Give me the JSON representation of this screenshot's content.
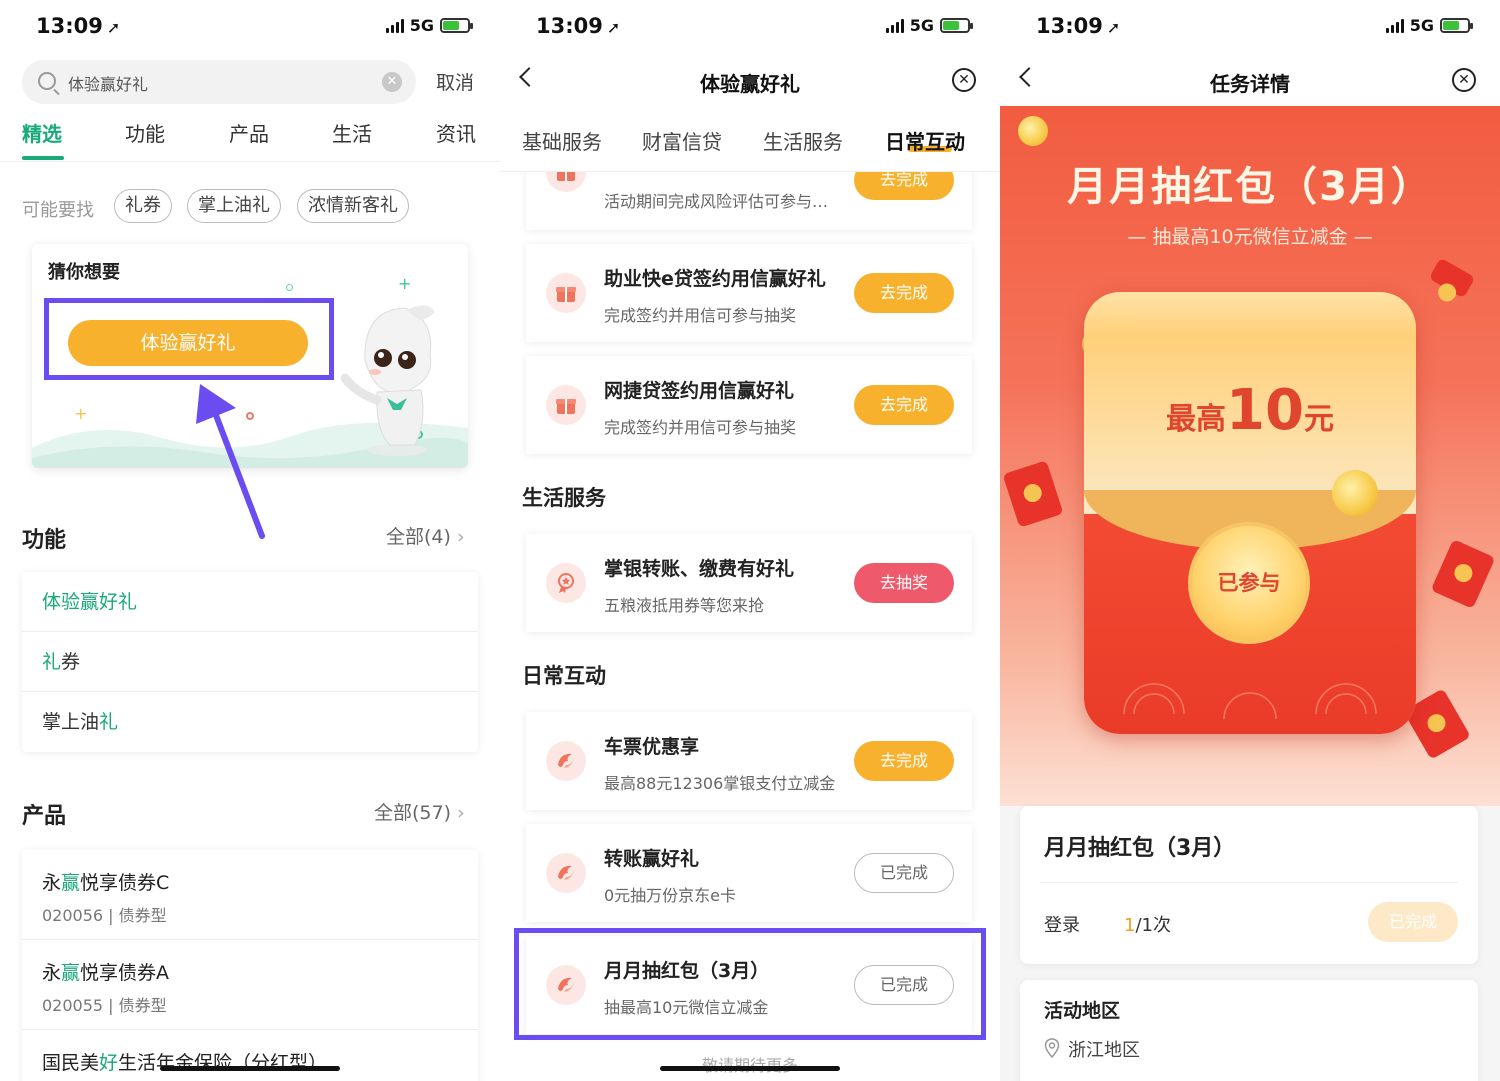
{
  "status": {
    "time": "13:09",
    "network": "5G"
  },
  "p1": {
    "search": {
      "query": "体验赢好礼",
      "cancel": "取消"
    },
    "tabs": [
      "精选",
      "功能",
      "产品",
      "生活",
      "资讯"
    ],
    "maybe_label": "可能要找",
    "chips": [
      "礼券",
      "掌上油礼",
      "浓情新客礼"
    ],
    "guess": {
      "title": "猜你想要",
      "button": "体验赢好礼"
    },
    "func": {
      "title": "功能",
      "all": "全部(4)"
    },
    "func_items": [
      {
        "pre": "",
        "hl": "体验赢好礼",
        "post": ""
      },
      {
        "pre": "",
        "hl": "礼",
        "post": "券"
      },
      {
        "pre": "掌上油",
        "hl": "礼",
        "post": ""
      }
    ],
    "prod": {
      "title": "产品",
      "all": "全部(57)"
    },
    "prod_items": [
      {
        "pre": "永",
        "hl": "赢",
        "post": "悦享债券C",
        "sub": "020056 | 债券型"
      },
      {
        "pre": "永",
        "hl": "赢",
        "post": "悦享债券A",
        "sub": "020055 | 债券型"
      },
      {
        "pre": "国民美",
        "hl": "好",
        "post": "生活年金保险（分红型）",
        "sub": ""
      }
    ]
  },
  "p2": {
    "title": "体验赢好礼",
    "tabs": [
      "基础服务",
      "财富信贷",
      "生活服务",
      "日常互动"
    ],
    "tasks_top": [
      {
        "title": "",
        "sub": "活动期间完成风险评估可参与…",
        "btn": "去完成"
      },
      {
        "title": "助业快e贷签约用信赢好礼",
        "sub": "完成签约并用信可参与抽奖",
        "btn": "去完成"
      },
      {
        "title": "网捷贷签约用信赢好礼",
        "sub": "完成签约并用信可参与抽奖",
        "btn": "去完成"
      }
    ],
    "sec_life": "生活服务",
    "tasks_life": [
      {
        "title": "掌银转账、缴费有好礼",
        "sub": "五粮液抵用券等您来抢",
        "btn": "去抽奖"
      }
    ],
    "sec_daily": "日常互动",
    "tasks_daily": [
      {
        "title": "车票优惠享",
        "sub": "最高88元12306掌银支付立减金",
        "btn": "去完成"
      },
      {
        "title": "转账赢好礼",
        "sub": "0元抽万份京东e卡",
        "btn": "已完成"
      },
      {
        "title": "月月抽红包（3月）",
        "sub": "抽最高10元微信立减金",
        "btn": "已完成"
      }
    ],
    "more": "敬请期待更多"
  },
  "p3": {
    "title": "任务详情",
    "banner_title": "月月抽红包（3月）",
    "banner_sub": "抽最高10元微信立减金",
    "amount_pre": "最高",
    "amount_num": "10",
    "amount_post": "元",
    "joined": "已参与",
    "card_title": "月月抽红包（3月）",
    "login_label": "登录",
    "login_done": "1",
    "login_total": "/1次",
    "done_btn": "已完成",
    "area_title": "活动地区",
    "area_value": "浙江地区"
  }
}
